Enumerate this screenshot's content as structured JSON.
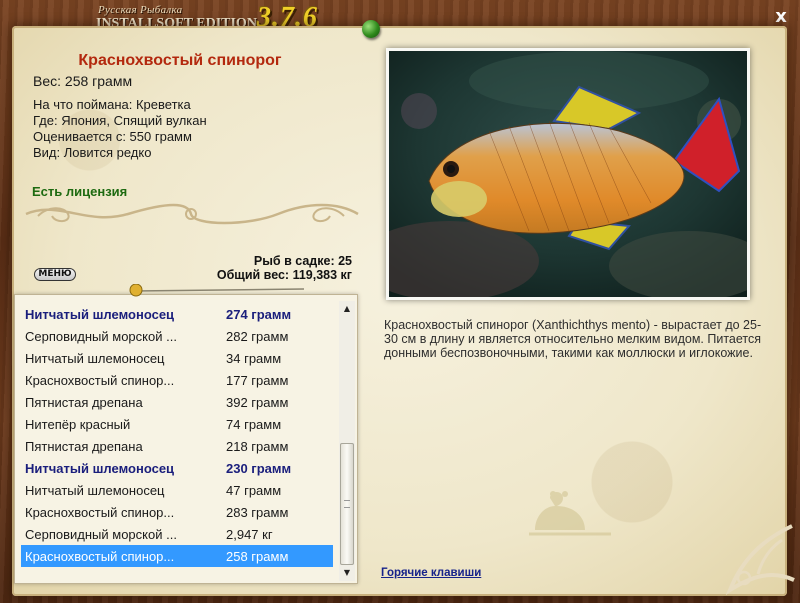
{
  "window": {
    "logo_line1": "Русская Рыбалка",
    "logo_line2": "INSTALLSOFT EDITION",
    "version": "3.7.6",
    "close_label": "x"
  },
  "fish": {
    "title": "Краснохвостый спинорог",
    "weight": "Вес: 258 грамм",
    "bait": "На что поймана: Креветка",
    "location": "Где: Япония, Спящий вулкан",
    "value": "Оценивается с: 550 грамм",
    "type": "Вид: Ловится редко",
    "license": "Есть лицензия",
    "description": "Краснохвостый спинорог (Xanthichthys mento) - вырастает до 25-30 см в длину и является относительно мелким видом. Питается донными беспозвоночными, такими как моллюски и иглокожие."
  },
  "keepnet": {
    "count": "Рыб в садке: 25",
    "total_weight": "Общий вес: 119,383 кг"
  },
  "menu_label": "МЕНЮ",
  "hotkeys_label": "Горячие клавиши",
  "list": [
    {
      "name": "Нитчатый шлемоносец",
      "weight": "274 грамм",
      "style": "bold"
    },
    {
      "name": "Серповидный морской ...",
      "weight": "282 грамм",
      "style": ""
    },
    {
      "name": "Нитчатый шлемоносец",
      "weight": "34 грамм",
      "style": ""
    },
    {
      "name": "Краснохвостый спинор...",
      "weight": "177 грамм",
      "style": ""
    },
    {
      "name": "Пятнистая дрепана",
      "weight": "392 грамм",
      "style": ""
    },
    {
      "name": "Нитепёр красный",
      "weight": "74 грамм",
      "style": ""
    },
    {
      "name": "Пятнистая дрепана",
      "weight": "218 грамм",
      "style": ""
    },
    {
      "name": "Нитчатый шлемоносец",
      "weight": "230 грамм",
      "style": "bold"
    },
    {
      "name": "Нитчатый шлемоносец",
      "weight": "47 грамм",
      "style": ""
    },
    {
      "name": "Краснохвостый спинор...",
      "weight": "283 грамм",
      "style": ""
    },
    {
      "name": "Серповидный морской ...",
      "weight": "2,947 кг",
      "style": ""
    },
    {
      "name": "Краснохвостый спинор...",
      "weight": "258 грамм",
      "style": "selected"
    }
  ],
  "colors": {
    "title_red": "#b3280e",
    "license_green": "#1d6a10",
    "bold_row_blue": "#1a1e7c",
    "selection_blue": "#3399ff",
    "version_yellow": "#f0d028"
  }
}
